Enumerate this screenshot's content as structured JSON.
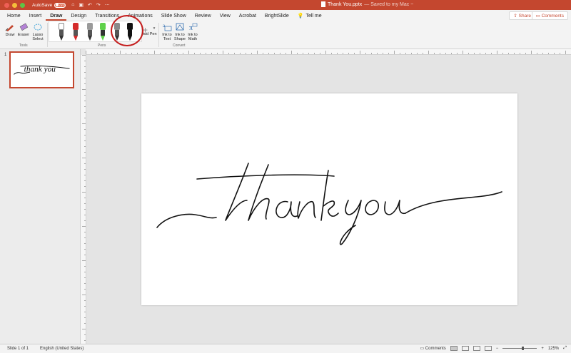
{
  "titlebar": {
    "autosave_label": "AutoSave",
    "autosave_state": "OFF",
    "document_name": "Thank You.pptx",
    "save_status": "— Saved to my Mac ~"
  },
  "tabs": [
    {
      "label": "Home"
    },
    {
      "label": "Insert"
    },
    {
      "label": "Draw",
      "active": true
    },
    {
      "label": "Design"
    },
    {
      "label": "Transitions"
    },
    {
      "label": "Animations"
    },
    {
      "label": "Slide Show"
    },
    {
      "label": "Review"
    },
    {
      "label": "View"
    },
    {
      "label": "Acrobat"
    },
    {
      "label": "BrightSlide"
    }
  ],
  "tell_me": "Tell me",
  "share_label": "Share",
  "comments_label": "Comments",
  "ribbon": {
    "tools": {
      "draw": "Draw",
      "eraser": "Eraser",
      "lasso": "Lasso Select",
      "group": "Tools"
    },
    "pens": {
      "group": "Pens",
      "add_pen": "Add Pen",
      "colors": [
        "#ffffff",
        "#d42a2a",
        "#9a9a9a",
        "#5fd14a",
        "#8a8a8a",
        "#111111"
      ]
    },
    "convert": {
      "ink_to_text": "Ink to Text",
      "ink_to_shape": "Ink to Shape",
      "ink_to_math": "Ink to Math",
      "group": "Convert"
    }
  },
  "thumbnails": [
    {
      "number": "1",
      "text": "thank you"
    }
  ],
  "slide": {
    "ink_text": "thank you"
  },
  "statusbar": {
    "slide_info": "Slide 1 of 1",
    "language": "English (United States)",
    "comments": "Comments",
    "zoom": "125%"
  },
  "colors": {
    "accent": "#c4472f",
    "selection_circle": "#c41c1c"
  }
}
